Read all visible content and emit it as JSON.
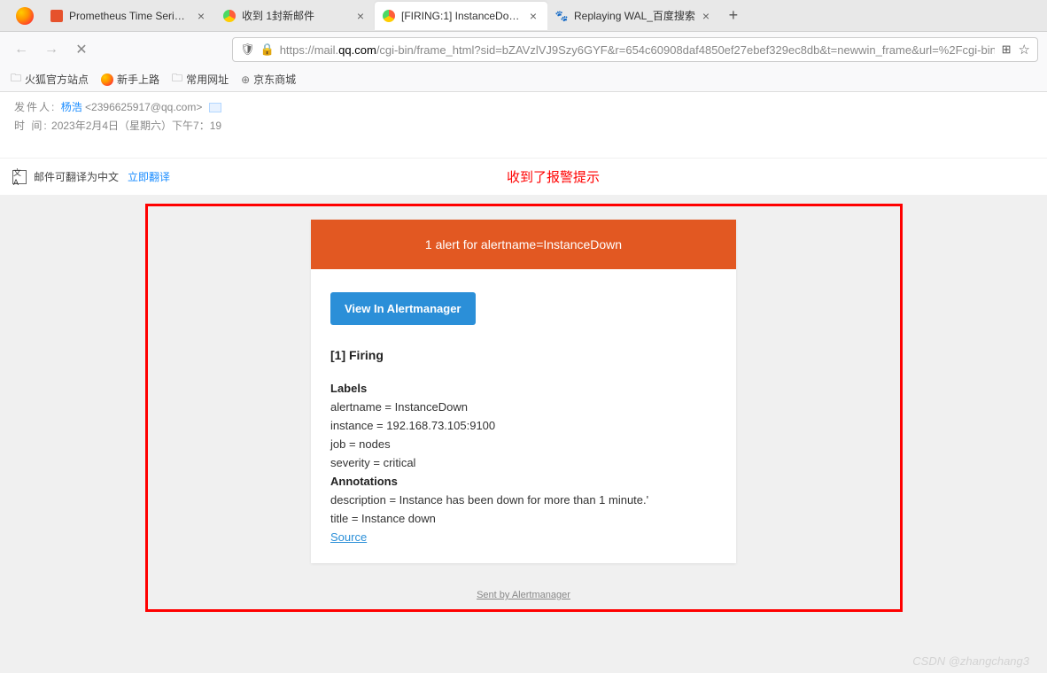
{
  "tabs": [
    {
      "title": "Prometheus Time Series Colle"
    },
    {
      "title": "收到 1封新邮件"
    },
    {
      "title": "[FIRING:1] InstanceDown (19"
    },
    {
      "title": "Replaying WAL_百度搜索"
    }
  ],
  "url": {
    "prefix": "https://mail.",
    "domain": "qq.com",
    "path": "/cgi-bin/frame_html?sid=bZAVzlVJ9Szy6GYF&r=654c60908daf4850ef27ebef329ec8db&t=newwin_frame&url=%2Fcgi-bin%2"
  },
  "bookmarks": [
    {
      "label": "火狐官方站点"
    },
    {
      "label": "新手上路"
    },
    {
      "label": "常用网址"
    },
    {
      "label": "京东商城"
    }
  ],
  "mail": {
    "sender_label": "发件人:",
    "sender_name": "杨浩",
    "sender_email": "<2396625917@qq.com>",
    "time_label": "时   间:",
    "time_value": "2023年2月4日（星期六）下午7：19"
  },
  "translate": {
    "text": "邮件可翻译为中文",
    "link": "立即翻译",
    "annotation": "收到了报警提示"
  },
  "alert": {
    "header": "1 alert for alertname=InstanceDown",
    "button": "View In Alertmanager",
    "firing_title": "[1] Firing",
    "labels_heading": "Labels",
    "labels": [
      "alertname = InstanceDown",
      "instance = 192.168.73.105:9100",
      "job = nodes",
      "severity = critical"
    ],
    "annotations_heading": "Annotations",
    "annotations": [
      "description = Instance has been down for more than 1 minute.'",
      "title = Instance down"
    ],
    "source_link": "Source",
    "footer": "Sent by Alertmanager"
  },
  "watermark": "CSDN @zhangchang3"
}
